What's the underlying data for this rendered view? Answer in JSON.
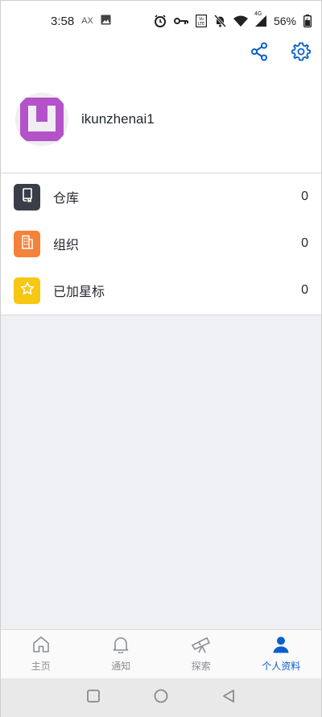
{
  "status_bar": {
    "time": "3:58",
    "ax_label": "AX",
    "network": "4G",
    "battery": "56%"
  },
  "header": {
    "share_icon": "share-icon",
    "settings_icon": "gear-icon"
  },
  "profile": {
    "username": "ikunzhenai1",
    "avatar_color": "#b453c9"
  },
  "list": {
    "items": [
      {
        "label": "仓库",
        "count": "0",
        "icon": "repo-icon",
        "color": "#3a3e48"
      },
      {
        "label": "组织",
        "count": "0",
        "icon": "organization-icon",
        "color": "#f5823a"
      },
      {
        "label": "已加星标",
        "count": "0",
        "icon": "star-icon",
        "color": "#f6c713"
      }
    ]
  },
  "tabbar": {
    "tabs": [
      {
        "label": "主页",
        "icon": "home-icon"
      },
      {
        "label": "通知",
        "icon": "bell-icon"
      },
      {
        "label": "探索",
        "icon": "telescope-icon"
      },
      {
        "label": "个人资料",
        "icon": "person-icon",
        "active": true
      }
    ]
  },
  "colors": {
    "accent": "#0a5fcf",
    "content_bg": "#eff0f4"
  }
}
